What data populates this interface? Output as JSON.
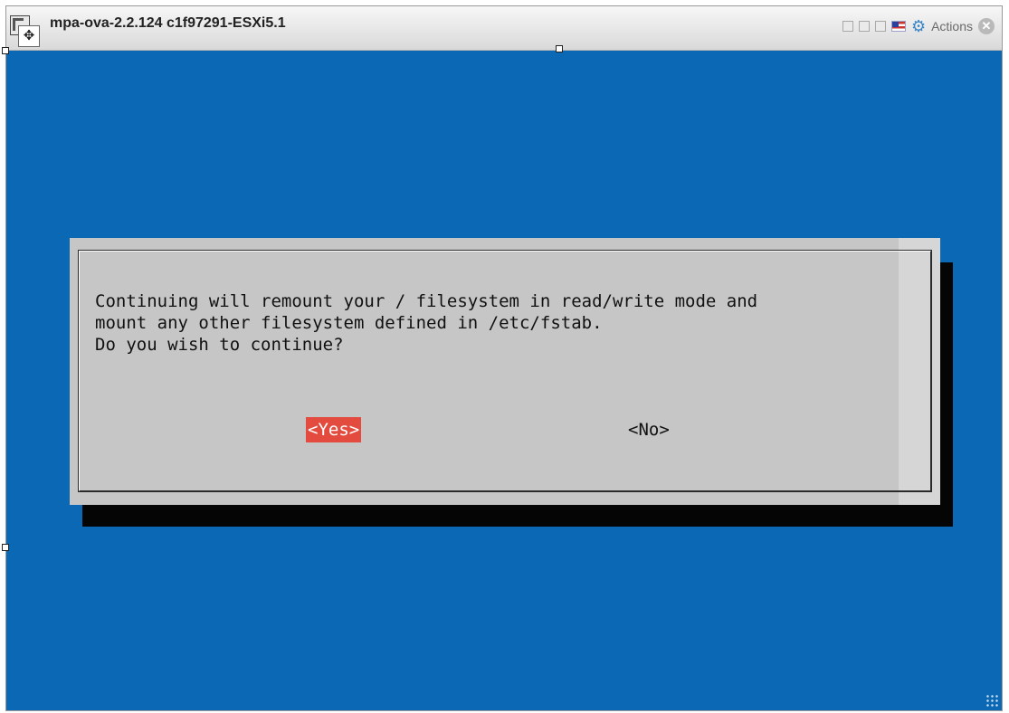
{
  "window": {
    "title": "mpa-ova-2.2.124 c1f97291-ESXi5.1",
    "actions_label": "Actions",
    "close_glyph": "✕",
    "gear_glyph": "⚙",
    "move_glyph": "✥"
  },
  "dialog": {
    "message_lines": [
      "Continuing will remount your / filesystem in read/write mode and",
      "mount any other filesystem defined in /etc/fstab.",
      "Do you wish to continue?"
    ],
    "yes_label": "<Yes>",
    "no_label": "<No>"
  },
  "icons": [
    "app-window-icon",
    "move-icon",
    "minimize-icon",
    "restore-icon",
    "maximize-icon",
    "language-flag-icon",
    "gear-icon",
    "close-icon",
    "resize-grip-icon"
  ],
  "colors": {
    "console_background": "#0a68b5",
    "dialog_background": "#c6c6c6",
    "selected_button": "#e24b3d",
    "dialog_shadow": "#050505"
  }
}
